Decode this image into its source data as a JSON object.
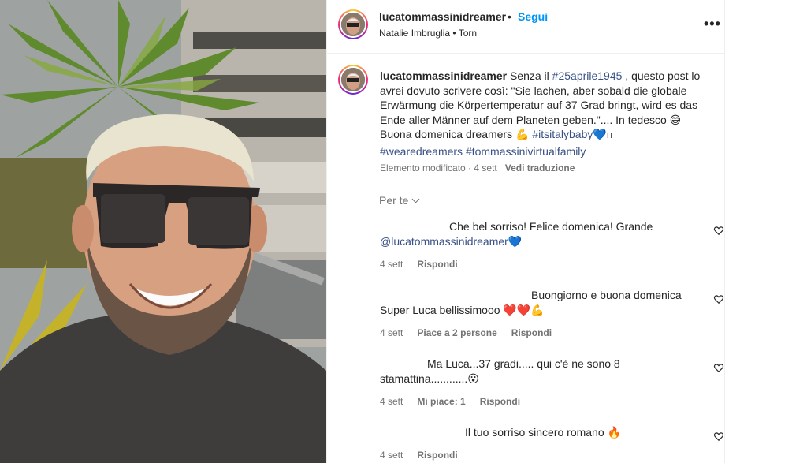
{
  "post": {
    "username": "lucatommassinidreamer",
    "separator": "•",
    "follow_label": "Segui",
    "audio": "Natalie Imbruglia • Torn",
    "more_label": "•••"
  },
  "caption": {
    "username": "lucatommassinidreamer",
    "text1": " Senza il ",
    "hashtag1": "#25aprile1945",
    "text2": " , questo post lo avrei dovuto scrivere così: \"Sie lachen, aber sobald die globale Erwärmung die Körpertemperatur auf 37 Grad bringt, wird es das Ende aller Männer auf dem Planeten geben.\".... In tedesco ",
    "emoji1": "😅",
    "text3": " Buona domenica dreamers ",
    "emoji2": "💪",
    "hashtag2": " #itsitalybaby",
    "emoji3": "💙",
    "text4": "IT ",
    "hashtag3": "#wearedreamers #tommassinivirtualfamily",
    "edited": "Elemento modificato · 4 sett",
    "translate": "Vedi traduzione"
  },
  "sort_label": "Per te",
  "comments": [
    {
      "text": "Che bel sorriso! Felice domenica! Grande ",
      "mention": "@lucatommassinidreamer",
      "emoji": "💙",
      "time": "4 sett",
      "likes": "",
      "reply": "Rispondi"
    },
    {
      "text": "Buongiorno e buona domenica Super Luca bellissimooo ",
      "emoji": "❤️❤️💪",
      "time": "4 sett",
      "likes": "Piace a 2 persone",
      "reply": "Rispondi"
    },
    {
      "text": "Ma Luca...37 gradi..... qui c'è ne sono 8 stamattina............",
      "emoji": "😮",
      "time": "4 sett",
      "likes": "Mi piace: 1",
      "reply": "Rispondi"
    },
    {
      "text": "Il tuo sorriso sincero romano ",
      "emoji": "🔥",
      "time": "4 sett",
      "likes": "",
      "reply": "Rispondi"
    }
  ],
  "icons": {
    "heart": "heart-outline-icon",
    "more": "more-horizontal-icon",
    "chevron": "chevron-down-icon"
  },
  "colors": {
    "link_blue": "#0095f6",
    "hashtag_blue": "#385185",
    "muted": "#737373",
    "text": "#262626"
  }
}
